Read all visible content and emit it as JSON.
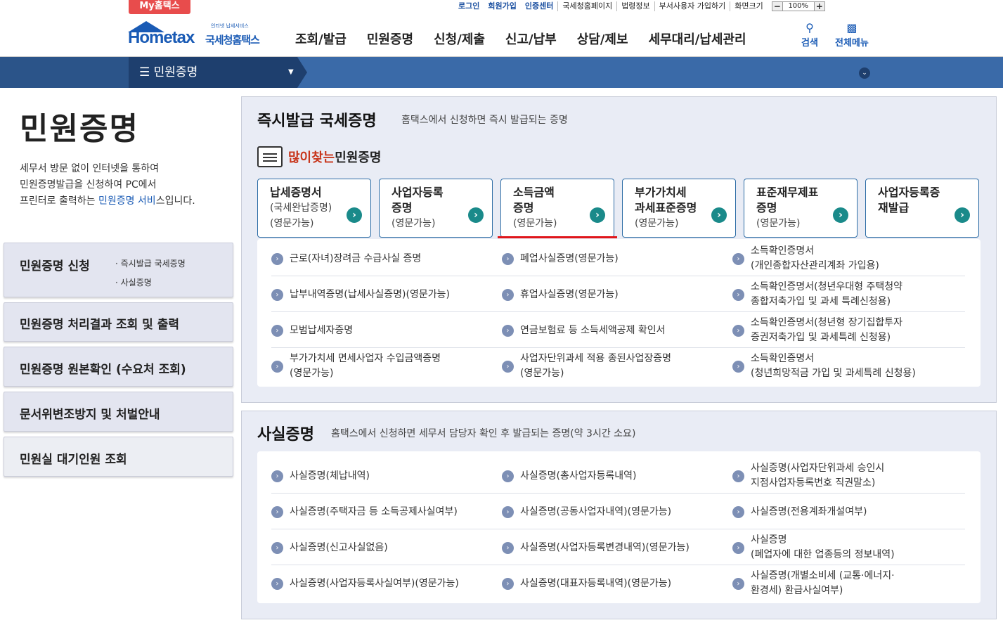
{
  "top": {
    "my_hometax": "My홈택스",
    "links": [
      "로그인",
      "회원가입",
      "인증센터",
      "국세청홈페이지",
      "법령정보",
      "부서사용자 가입하기",
      "화면크기"
    ],
    "zoom_minus": "−",
    "zoom_value": "100%",
    "zoom_plus": "+"
  },
  "header": {
    "logo_text": "Hometax",
    "logo_kr": "국세청홈택스",
    "logo_tag": "인터넷 납세서비스",
    "gnb": [
      "조회/발급",
      "민원증명",
      "신청/제출",
      "신고/납부",
      "상담/제보",
      "세무대리/납세관리"
    ],
    "search_label": "검색",
    "allmenu_label": "전체메뉴"
  },
  "subbar": {
    "menu_label": "☰  민원증명"
  },
  "side": {
    "title": "민원증명",
    "desc1": "세무서 방문 없이 인터넷을 통하여",
    "desc2": "민원증명발급을 신청하여 PC에서",
    "desc3_pre": "프린터로 출력하는 ",
    "desc3_link": "민원증명 서비",
    "desc3_post": "스입니다.",
    "nav": [
      {
        "label": "민원증명 신청",
        "subs": [
          "· 즉시발급 국세증명",
          "· 사실증명"
        ]
      },
      {
        "label": "민원증명 처리결과 조회 및 출력"
      },
      {
        "label": "민원증명 원본확인 (수요처 조회)"
      },
      {
        "label": "문서위변조방지 및 처벌안내"
      },
      {
        "label": "민원실 대기인원 조회"
      }
    ]
  },
  "instant": {
    "title": "즉시발급 국세증명",
    "subtitle": "홈택스에서 신청하면 즉시 발급되는 증명",
    "popular_hl": "많이찾는",
    "popular_rest": " 민원증명",
    "cards": [
      {
        "l1": "납세증명서",
        "l2": "(국세완납증명)",
        "l3": "(영문가능)"
      },
      {
        "l1": "사업자등록",
        "l2": "증명",
        "l3": "(영문가능)"
      },
      {
        "l1": "소득금액",
        "l2": "증명",
        "l3": "(영문가능)"
      },
      {
        "l1": "부가가치세",
        "l2": "과세표준증명",
        "l3": "(영문가능)"
      },
      {
        "l1": "표준재무제표",
        "l2": "증명",
        "l3": "(영문가능)"
      },
      {
        "l1": "사업자등록증",
        "l2": "재발급",
        "l3": ""
      }
    ],
    "items": [
      [
        "근로(자녀)장려금 수급사실 증명",
        "폐업사실증명(영문가능)",
        "소득확인증명서\n(개인종합자산관리계좌 가입용)"
      ],
      [
        "납부내역증명(납세사실증명)(영문가능)",
        "휴업사실증명(영문가능)",
        "소득확인증명서(청년우대형 주택청약\n종합저축가입 및 과세 특례신청용)"
      ],
      [
        "모범납세자증명",
        "연금보험료 등 소득세액공제 확인서",
        "소득확인증명서(청년형 장기집합투자\n증권저축가입 및 과세특례 신청용)"
      ],
      [
        "부가가치세 면세사업자 수입금액증명\n(영문가능)",
        "사업자단위과세 적용 종된사업장증명\n(영문가능)",
        "소득확인증명서\n(청년희망적금 가입 및 과세특례 신청용)"
      ]
    ]
  },
  "fact": {
    "title": "사실증명",
    "subtitle": "홈택스에서 신청하면 세무서 담당자 확인 후 발급되는 증명(약 3시간 소요)",
    "items": [
      [
        "사실증명(체납내역)",
        "사실증명(총사업자등록내역)",
        "사실증명(사업자단위과세 승인시\n지점사업자등록번호 직권말소)"
      ],
      [
        "사실증명(주택자금 등 소득공제사실여부)",
        "사실증명(공동사업자내역)(영문가능)",
        "사실증명(전용계좌개설여부)"
      ],
      [
        "사실증명(신고사실없음)",
        "사실증명(사업자등록변경내역)(영문가능)",
        "사실증명\n(폐업자에 대한 업종등의 정보내역)"
      ],
      [
        "사실증명(사업자등록사실여부)(영문가능)",
        "사실증명(대표자등록내역)(영문가능)",
        "사실증명(개별소비세 (교통·에너지·\n환경세) 환급사실여부)"
      ]
    ]
  }
}
